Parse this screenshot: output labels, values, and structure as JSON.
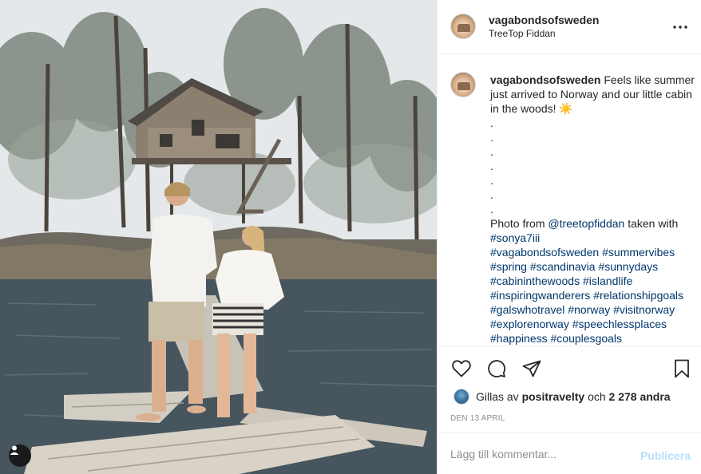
{
  "post": {
    "username": "vagabondsofsweden",
    "location": "TreeTop Fiddan"
  },
  "caption": {
    "username": "vagabondsofsweden",
    "text": "Feels like summer just arrived to Norway and our little cabin in the woods! ☀️",
    "dots": [
      ".",
      ".",
      ".",
      ".",
      ".",
      ".",
      "."
    ],
    "photo_from_prefix": "Photo from ",
    "photo_credit": "@treetopfiddan",
    "taken_with": " taken with",
    "mention": "#sonya7iii",
    "hashtags": [
      "#vagabondsofsweden",
      "#summervibes",
      "#spring",
      "#scandinavia",
      "#sunnydays",
      "#cabininthewoods",
      "#islandlife",
      "#inspiringwanderers",
      "#relationshipgoals",
      "#galswhotravel",
      "#norway",
      "#visitnorway",
      "#explorenorway",
      "#speechlessplaces",
      "#happiness",
      "#couplesgoals"
    ]
  },
  "likes": {
    "prefix": "Gillas av",
    "liker": "positravelty",
    "conjunction": "och",
    "others": "2 278 andra"
  },
  "date": "DEN 13 APRIL",
  "comment": {
    "placeholder": "Lägg till kommentar...",
    "publish_label": "Publicera"
  },
  "icons": {
    "more": "more-options-icon",
    "like": "heart-icon",
    "comment": "comment-icon",
    "share": "share-icon",
    "save": "bookmark-icon",
    "user_tag": "user-tag-icon"
  },
  "colors": {
    "link": "#00376b",
    "publish_disabled": "#b2dffc",
    "muted": "#8e8e8e",
    "border": "#efefef"
  }
}
